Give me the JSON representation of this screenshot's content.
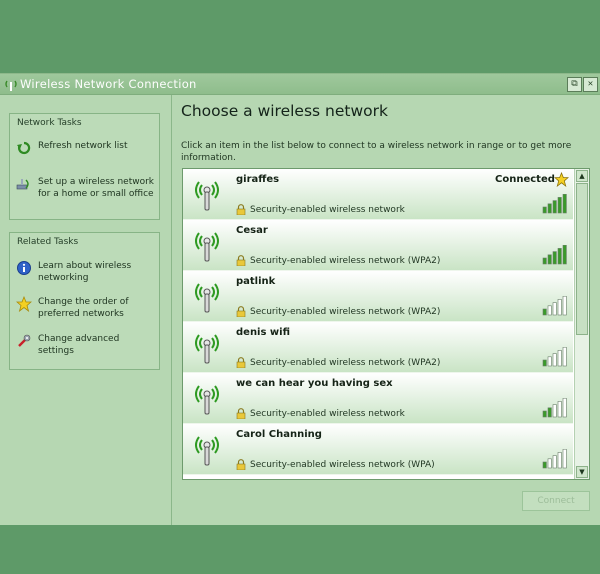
{
  "window": {
    "title": "Wireless Network Connection",
    "restore_glyph": "⧉",
    "close_glyph": "✕"
  },
  "network_tasks": {
    "header": "Network Tasks",
    "items": [
      {
        "label": "Refresh network list",
        "icon": "refresh-icon"
      },
      {
        "label": "Set up a wireless network for a home or small office",
        "icon": "setup-network-icon"
      }
    ]
  },
  "related_tasks": {
    "header": "Related Tasks",
    "items": [
      {
        "label": "Learn about wireless networking",
        "icon": "info-icon"
      },
      {
        "label": "Change the order of preferred networks",
        "icon": "star-icon"
      },
      {
        "label": "Change advanced settings",
        "icon": "settings-icon"
      }
    ]
  },
  "main": {
    "title": "Choose a wireless network",
    "instructions": "Click an item in the list below to connect to a wireless network in range or to get more information."
  },
  "networks": [
    {
      "name": "giraffes",
      "security": "Security-enabled wireless network",
      "status": "Connected",
      "signal": 5
    },
    {
      "name": "Cesar",
      "security": "Security-enabled wireless network (WPA2)",
      "status": "",
      "signal": 5
    },
    {
      "name": "patlink",
      "security": "Security-enabled wireless network (WPA2)",
      "status": "",
      "signal": 1
    },
    {
      "name": "denis wifi",
      "security": "Security-enabled wireless network (WPA2)",
      "status": "",
      "signal": 1
    },
    {
      "name": "we can hear you having sex",
      "security": "Security-enabled wireless network",
      "status": "",
      "signal": 2
    },
    {
      "name": "Carol Channing",
      "security": "Security-enabled wireless network (WPA)",
      "status": "",
      "signal": 1
    }
  ],
  "connect_button": "Connect",
  "colors": {
    "background": "#5e9a68",
    "window": "#b6d7b2",
    "signal_on": "#3a9a2a",
    "signal_off": "#ffffff"
  }
}
